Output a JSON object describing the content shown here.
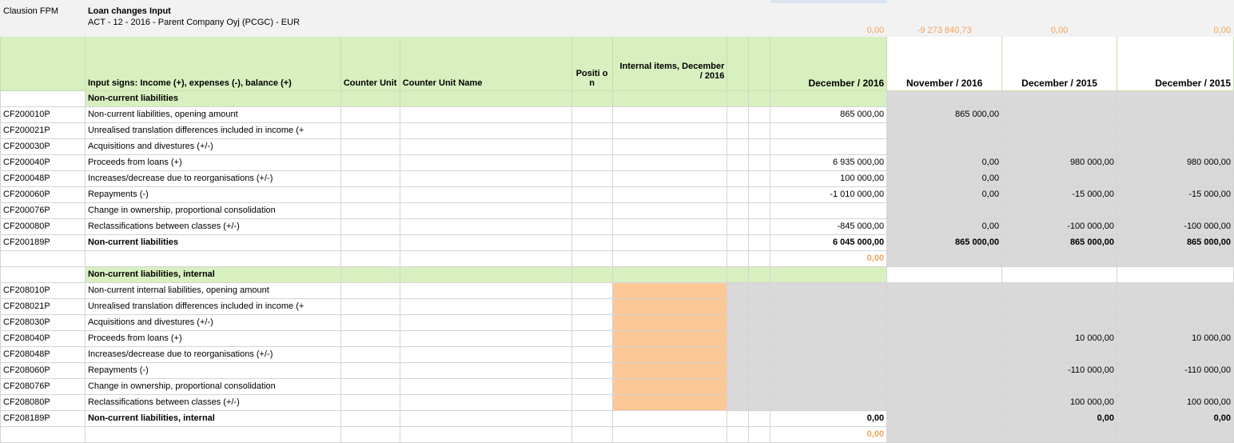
{
  "info": {
    "label": "Clausion FPM",
    "title": "Loan changes Input",
    "subtitle": "ACT - 12 - 2016 - Parent Company Oyj (PCGC) - EUR",
    "totals": [
      "0,00",
      "-9 273 840,73",
      "0,00",
      "0,00"
    ]
  },
  "headers": {
    "input_signs": "Input signs: Income (+), expenses (-), balance (+)",
    "counter_unit": "Counter Unit",
    "counter_unit_name": "Counter Unit Name",
    "position": "Positi on",
    "internal_items": "Internal items, December / 2016",
    "dec2016": "December / 2016",
    "nov2016": "November / 2016",
    "dec2015a": "December / 2015",
    "dec2015b": "December / 2015"
  },
  "sections": [
    {
      "title": "Non-current liabilities",
      "rows": [
        {
          "code": "CF200010P",
          "desc": "Non-current liabilities, opening amount",
          "c1": "865 000,00",
          "c2": "865 000,00",
          "c3": "",
          "c4": ""
        },
        {
          "code": "CF200021P",
          "desc": "Unrealised translation differences included in income (+",
          "c1": "",
          "c2": "",
          "c3": "",
          "c4": ""
        },
        {
          "code": "CF200030P",
          "desc": "Acquisitions and divestures (+/-)",
          "c1": "",
          "c2": "",
          "c3": "",
          "c4": ""
        },
        {
          "code": "CF200040P",
          "desc": "Proceeds from loans (+)",
          "c1": "6 935 000,00",
          "c2": "0,00",
          "c3": "980 000,00",
          "c4": "980 000,00"
        },
        {
          "code": "CF200048P",
          "desc": "Increases/decrease due to reorganisations (+/-)",
          "c1": "100 000,00",
          "c2": "0,00",
          "c3": "",
          "c4": ""
        },
        {
          "code": "CF200060P",
          "desc": "Repayments (-)",
          "c1": "-1 010 000,00",
          "c2": "0,00",
          "c3": "-15 000,00",
          "c4": "-15 000,00"
        },
        {
          "code": "CF200076P",
          "desc": "Change in ownership, proportional consolidation",
          "c1": "",
          "c2": "",
          "c3": "",
          "c4": ""
        },
        {
          "code": "CF200080P",
          "desc": "Reclassifications between classes (+/-)",
          "c1": "-845 000,00",
          "c2": "0,00",
          "c3": "-100 000,00",
          "c4": "-100 000,00"
        }
      ],
      "total": {
        "code": "CF200189P",
        "desc": "Non-current liabilities",
        "c1": "6 045 000,00",
        "c2": "865 000,00",
        "c3": "865 000,00",
        "c4": "865 000,00"
      },
      "check": "0,00"
    },
    {
      "title": "Non-current liabilities, internal",
      "rows": [
        {
          "code": "CF208010P",
          "desc": "Non-current internal liabilities, opening amount",
          "c1": "",
          "c2": "",
          "c3": "",
          "c4": ""
        },
        {
          "code": "CF208021P",
          "desc": "Unrealised translation differences included in income (+",
          "c1": "",
          "c2": "",
          "c3": "",
          "c4": ""
        },
        {
          "code": "CF208030P",
          "desc": "Acquisitions and divestures (+/-)",
          "c1": "",
          "c2": "",
          "c3": "",
          "c4": ""
        },
        {
          "code": "CF208040P",
          "desc": "Proceeds from loans (+)",
          "c1": "",
          "c2": "",
          "c3": "10 000,00",
          "c4": "10 000,00"
        },
        {
          "code": "CF208048P",
          "desc": "Increases/decrease due to reorganisations (+/-)",
          "c1": "",
          "c2": "",
          "c3": "",
          "c4": ""
        },
        {
          "code": "CF208060P",
          "desc": "Repayments (-)",
          "c1": "",
          "c2": "",
          "c3": "-110 000,00",
          "c4": "-110 000,00"
        },
        {
          "code": "CF208076P",
          "desc": "Change in ownership, proportional consolidation",
          "c1": "",
          "c2": "",
          "c3": "",
          "c4": ""
        },
        {
          "code": "CF208080P",
          "desc": "Reclassifications between classes (+/-)",
          "c1": "",
          "c2": "",
          "c3": "100 000,00",
          "c4": "100 000,00"
        }
      ],
      "total": {
        "code": "CF208189P",
        "desc": "Non-current liabilities, internal",
        "c1": "0,00",
        "c2": "",
        "c3": "0,00",
        "c4": "0,00"
      },
      "check": "0,00"
    }
  ],
  "colors": {
    "header_green": "#d8f0c0",
    "gray": "#d9d9d9",
    "peach": "#fcc896",
    "orange_text": "#f5a25a"
  }
}
